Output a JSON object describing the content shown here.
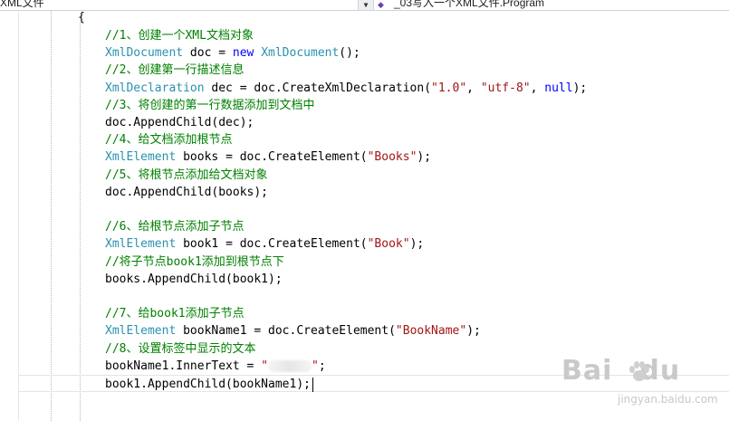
{
  "toolbar": {
    "left_dropdown": "XML文件",
    "right_dropdown": "_03写入一个XML文件.Program"
  },
  "code": {
    "brace": "{",
    "lines": [
      [
        {
          "c": "cm",
          "t": "//1、创建一个XML文档对象"
        }
      ],
      [
        {
          "c": "ty",
          "t": "XmlDocument"
        },
        {
          "c": "pl",
          "t": " doc = "
        },
        {
          "c": "kw",
          "t": "new"
        },
        {
          "c": "pl",
          "t": " "
        },
        {
          "c": "ty",
          "t": "XmlDocument"
        },
        {
          "c": "pl",
          "t": "();"
        }
      ],
      [
        {
          "c": "cm",
          "t": "//2、创建第一行描述信息"
        }
      ],
      [
        {
          "c": "ty",
          "t": "XmlDeclaration"
        },
        {
          "c": "pl",
          "t": " dec = doc.CreateXmlDeclaration("
        },
        {
          "c": "st",
          "t": "\"1.0\""
        },
        {
          "c": "pl",
          "t": ", "
        },
        {
          "c": "st",
          "t": "\"utf-8\""
        },
        {
          "c": "pl",
          "t": ", "
        },
        {
          "c": "kw",
          "t": "null"
        },
        {
          "c": "pl",
          "t": ");"
        }
      ],
      [
        {
          "c": "cm",
          "t": "//3、将创建的第一行数据添加到文档中"
        }
      ],
      [
        {
          "c": "pl",
          "t": "doc.AppendChild(dec);"
        }
      ],
      [
        {
          "c": "cm",
          "t": "//4、给文档添加根节点"
        }
      ],
      [
        {
          "c": "ty",
          "t": "XmlElement"
        },
        {
          "c": "pl",
          "t": " books = doc.CreateElement("
        },
        {
          "c": "st",
          "t": "\"Books\""
        },
        {
          "c": "pl",
          "t": ");"
        }
      ],
      [
        {
          "c": "cm",
          "t": "//5、将根节点添加给文档对象"
        }
      ],
      [
        {
          "c": "pl",
          "t": "doc.AppendChild(books);"
        }
      ],
      [],
      [
        {
          "c": "cm",
          "t": "//6、给根节点添加子节点"
        }
      ],
      [
        {
          "c": "ty",
          "t": "XmlElement"
        },
        {
          "c": "pl",
          "t": " book1 = doc.CreateElement("
        },
        {
          "c": "st",
          "t": "\"Book\""
        },
        {
          "c": "pl",
          "t": ");"
        }
      ],
      [
        {
          "c": "cm",
          "t": "//将子节点book1添加到根节点下"
        }
      ],
      [
        {
          "c": "pl",
          "t": "books.AppendChild(book1);"
        }
      ],
      [],
      [
        {
          "c": "cm",
          "t": "//7、给book1添加子节点"
        }
      ],
      [
        {
          "c": "ty",
          "t": "XmlElement"
        },
        {
          "c": "pl",
          "t": " bookName1 = doc.CreateElement("
        },
        {
          "c": "st",
          "t": "\"BookName\""
        },
        {
          "c": "pl",
          "t": ");"
        }
      ],
      [
        {
          "c": "cm",
          "t": "//8、设置标签中显示的文本"
        }
      ],
      [
        {
          "c": "pl",
          "t": "bookName1.InnerText = "
        },
        {
          "c": "st",
          "t": "\""
        },
        {
          "blur": true
        },
        {
          "c": "st",
          "t": "\""
        },
        {
          "c": "pl",
          "t": ";"
        }
      ],
      [
        {
          "c": "pl",
          "t": "book1.AppendChild(bookName1);"
        },
        {
          "caret": true
        }
      ]
    ]
  },
  "watermark": {
    "logo": "Bai du",
    "sub": "jingyan.baidu.com"
  },
  "colors": {
    "comment": "#008000",
    "type": "#2b91af",
    "keyword": "#0000ff",
    "string": "#a31515"
  }
}
